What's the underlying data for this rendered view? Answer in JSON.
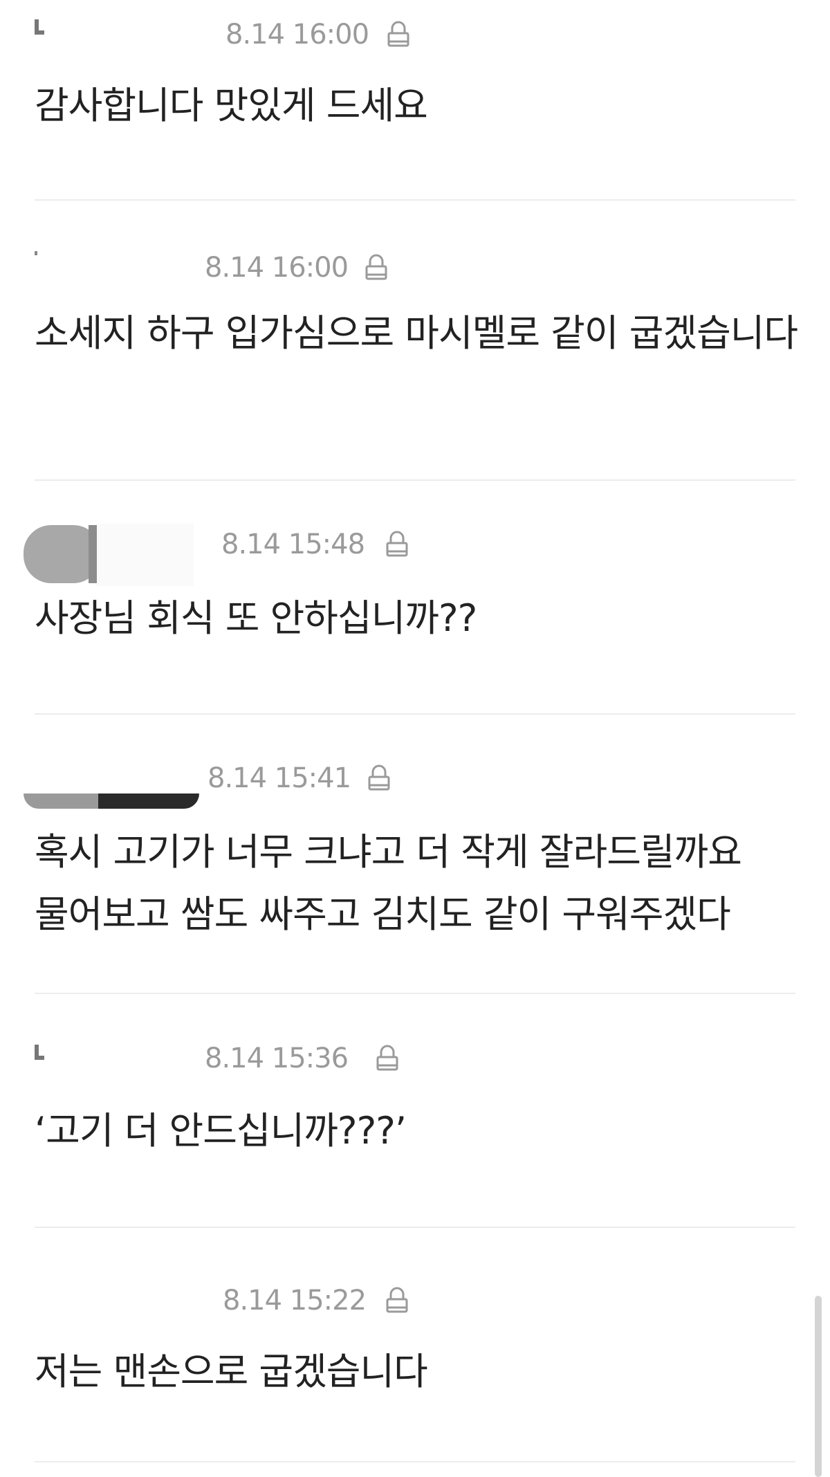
{
  "comments": [
    {
      "timestamp": "8.14 16:00",
      "text": "감사합니다 맛있게 드세요",
      "icon": "lock-icon"
    },
    {
      "timestamp": "8.14 16:00",
      "text": "소세지 하구 입가심으로 마시멜로 같이 굽겠습니다",
      "icon": "lock-icon"
    },
    {
      "timestamp": "8.14 15:48",
      "text": "사장님 회식 또 안하십니까??",
      "icon": "lock-icon"
    },
    {
      "timestamp": "8.14 15:41",
      "text": "혹시 고기가 너무 크냐고 더 작게 잘라드릴까요\n물어보고 쌈도 싸주고 김치도 같이 구워주겠다",
      "icon": "lock-icon"
    },
    {
      "timestamp": "8.14 15:36",
      "text": "‘고기 더 안드십니까???’",
      "icon": "lock-icon"
    },
    {
      "timestamp": "8.14 15:22",
      "text": "저는 맨손으로 굽겠습니다",
      "icon": "lock-icon"
    }
  ],
  "colors": {
    "meta_text": "#9a9a9a",
    "body_text": "#222222",
    "divider": "#ececec"
  }
}
